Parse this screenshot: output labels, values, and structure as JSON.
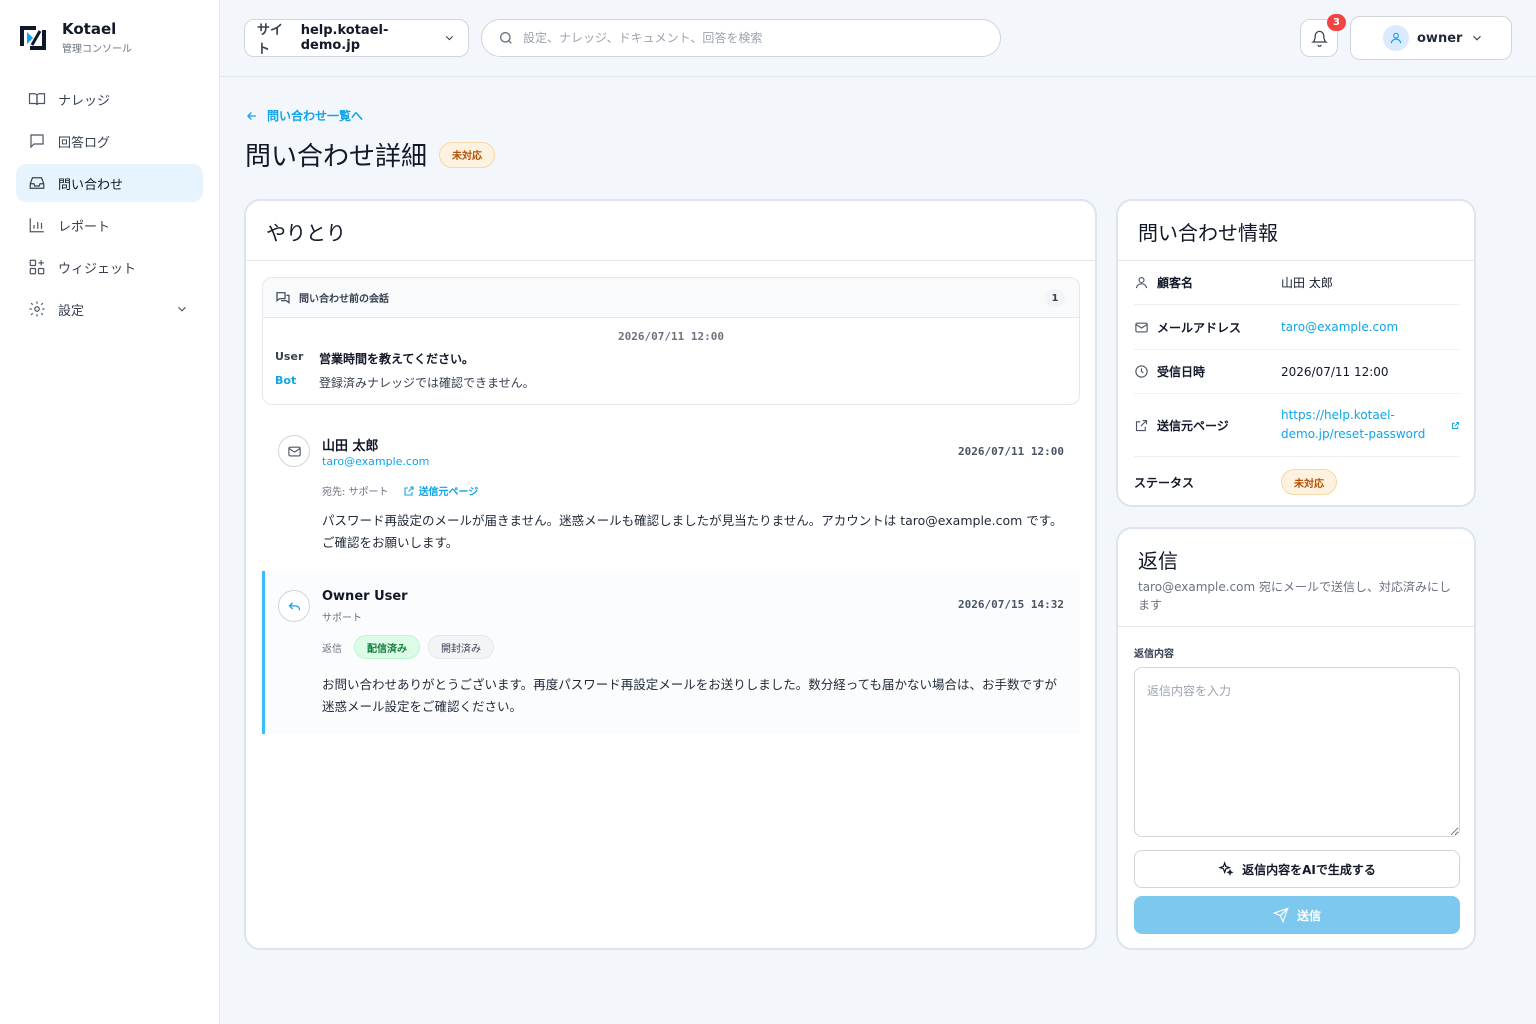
{
  "brand": {
    "name": "Kotael",
    "subtitle": "管理コンソール"
  },
  "sidebar": {
    "items": [
      {
        "label": "ナレッジ",
        "icon": "book-icon"
      },
      {
        "label": "回答ログ",
        "icon": "chat-icon"
      },
      {
        "label": "問い合わせ",
        "icon": "inbox-icon",
        "active": true
      },
      {
        "label": "レポート",
        "icon": "bar-chart-icon"
      },
      {
        "label": "ウィジェット",
        "icon": "widget-icon"
      },
      {
        "label": "設定",
        "icon": "gear-icon",
        "expandable": true
      }
    ]
  },
  "header": {
    "site_label": "サイト",
    "site_value": "help.kotael-demo.jp",
    "search_placeholder": "設定、ナレッジ、ドキュメント、回答を検索",
    "notification_count": "3",
    "user_name": "owner"
  },
  "page": {
    "back_link": "問い合わせ一覧へ",
    "title": "問い合わせ詳細",
    "status": "未対応"
  },
  "conversation": {
    "title": "やりとり",
    "pre_chat": {
      "title": "問い合わせ前の会話",
      "count": "1",
      "date": "2026/07/11 12:00",
      "messages": [
        {
          "role": "User",
          "text": "営業時間を教えてください。"
        },
        {
          "role": "Bot",
          "text": "登録済みナレッジでは確認できません。"
        }
      ]
    },
    "inbound": {
      "sender": "山田 太郎",
      "email": "taro@example.com",
      "date": "2026/07/11 12:00",
      "to_label": "宛先: サポート",
      "source_link": "送信元ページ",
      "body": "パスワード再設定のメールが届きません。迷惑メールも確認しましたが見当たりません。アカウントは taro@example.com です。ご確認をお願いします。"
    },
    "reply": {
      "sender": "Owner User",
      "role": "サポート",
      "date": "2026/07/15 14:32",
      "type_label": "返信",
      "tags": [
        "配信済み",
        "開封済み"
      ],
      "body": "お問い合わせありがとうございます。再度パスワード再設定メールをお送りしました。数分経っても届かない場合は、お手数ですが迷惑メール設定をご確認ください。"
    }
  },
  "info": {
    "title": "問い合わせ情報",
    "customer_label": "顧客名",
    "customer_value": "山田 太郎",
    "email_label": "メールアドレス",
    "email_value": "taro@example.com",
    "received_label": "受信日時",
    "received_value": "2026/07/11 12:00",
    "source_label": "送信元ページ",
    "source_value_1": "https://help.kotael-",
    "source_value_2": "demo.jp/reset-password",
    "status_label": "ステータス",
    "status_value": "未対応"
  },
  "reply_form": {
    "title": "返信",
    "description": "taro@example.com 宛にメールで送信し、対応済みにします",
    "field_label": "返信内容",
    "placeholder": "返信内容を入力",
    "ai_button": "返信内容をAIで生成する",
    "send_button": "送信"
  },
  "colors": {
    "accent": "#0ea5e9",
    "active_bg": "#e8f4fd",
    "warning": "#b45309",
    "success": "#15803d",
    "send_disabled": "#7cc8ee"
  }
}
